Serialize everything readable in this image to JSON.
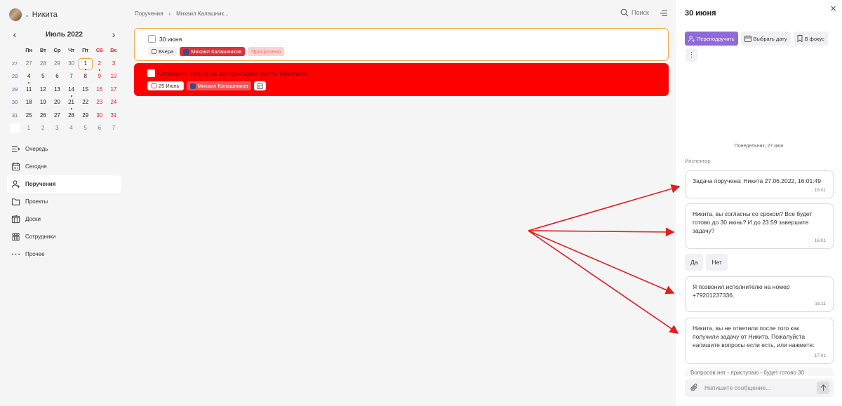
{
  "user": {
    "name": "Никита"
  },
  "calendar": {
    "month": "Июль 2022",
    "weekdays": [
      "Пн",
      "Вт",
      "Ср",
      "Чт",
      "Пт",
      "Сб",
      "Вс"
    ],
    "rows": [
      {
        "week": "27",
        "days": [
          "27",
          "28",
          "29",
          "30",
          "1",
          "2",
          "3"
        ]
      },
      {
        "week": "28",
        "days": [
          "4",
          "5",
          "6",
          "7",
          "8",
          "9",
          "10"
        ]
      },
      {
        "week": "29",
        "days": [
          "11",
          "12",
          "13",
          "14",
          "15",
          "16",
          "17"
        ]
      },
      {
        "week": "30",
        "days": [
          "18",
          "19",
          "20",
          "21",
          "22",
          "23",
          "24"
        ]
      },
      {
        "week": "31",
        "days": [
          "25",
          "26",
          "27",
          "28",
          "29",
          "30",
          "31"
        ]
      },
      {
        "week": "",
        "days": [
          "1",
          "2",
          "3",
          "4",
          "5",
          "6",
          "7"
        ]
      }
    ]
  },
  "nav": {
    "items": [
      {
        "label": "Очередь",
        "icon": "queue-icon"
      },
      {
        "label": "Сегодня",
        "icon": "calendar-today-icon"
      },
      {
        "label": "Поручения",
        "icon": "user-add-icon"
      },
      {
        "label": "Проекты",
        "icon": "folder-icon"
      },
      {
        "label": "Доски",
        "icon": "boards-icon"
      },
      {
        "label": "Сотрудники",
        "icon": "team-icon"
      },
      {
        "label": "Прочее",
        "icon": "more-dots-icon"
      }
    ]
  },
  "breadcrumb": {
    "root": "Поручения",
    "current": "Михаил Калашник..."
  },
  "search": {
    "label": "Поиск"
  },
  "tasks": [
    {
      "title": "30 июня",
      "date": "Вчера",
      "person": "Михаил Калашников",
      "status": "Просрочено"
    },
    {
      "title": "Отправить запрос на верификацию группы Вконтакте",
      "date": "25 Июль",
      "person": "Михаил Калашников"
    }
  ],
  "panel": {
    "title": "30 июня",
    "actions": {
      "reassign": "Переподручить",
      "pick_date": "Выбрать дату",
      "focus": "В фокус"
    },
    "day_separator": "Понедельник, 27 июн",
    "sender": "Инспектор",
    "messages": [
      {
        "text": "Задача поручена: Никита 27.06.2022, 16:01:49",
        "time": "16:01"
      },
      {
        "text": "Никита, вы согласны со сроком? Все будет готово до 30 июнь? И до 23:59 завершите задачу?",
        "time": "16:01"
      },
      {
        "text": "Я позвонил исполнителю на номер +79201237336.",
        "time": "16:11"
      },
      {
        "text": "Никита, вы не ответили после того как получили задачу от Никита. Пожалуйста напишите вопросы если есть, или нажмите:",
        "time": "17:01"
      }
    ],
    "quick_replies": {
      "yes": "Да",
      "no": "Нет"
    },
    "cut_text": "Вопросов нет - приступаю - будет готово 30",
    "composer_placeholder": "Напишите сообщение..."
  },
  "colors": {
    "accent": "#8f6ad8",
    "danger": "#fe0000",
    "overdue_border": "#f4a852",
    "arrow": "#e02020"
  }
}
